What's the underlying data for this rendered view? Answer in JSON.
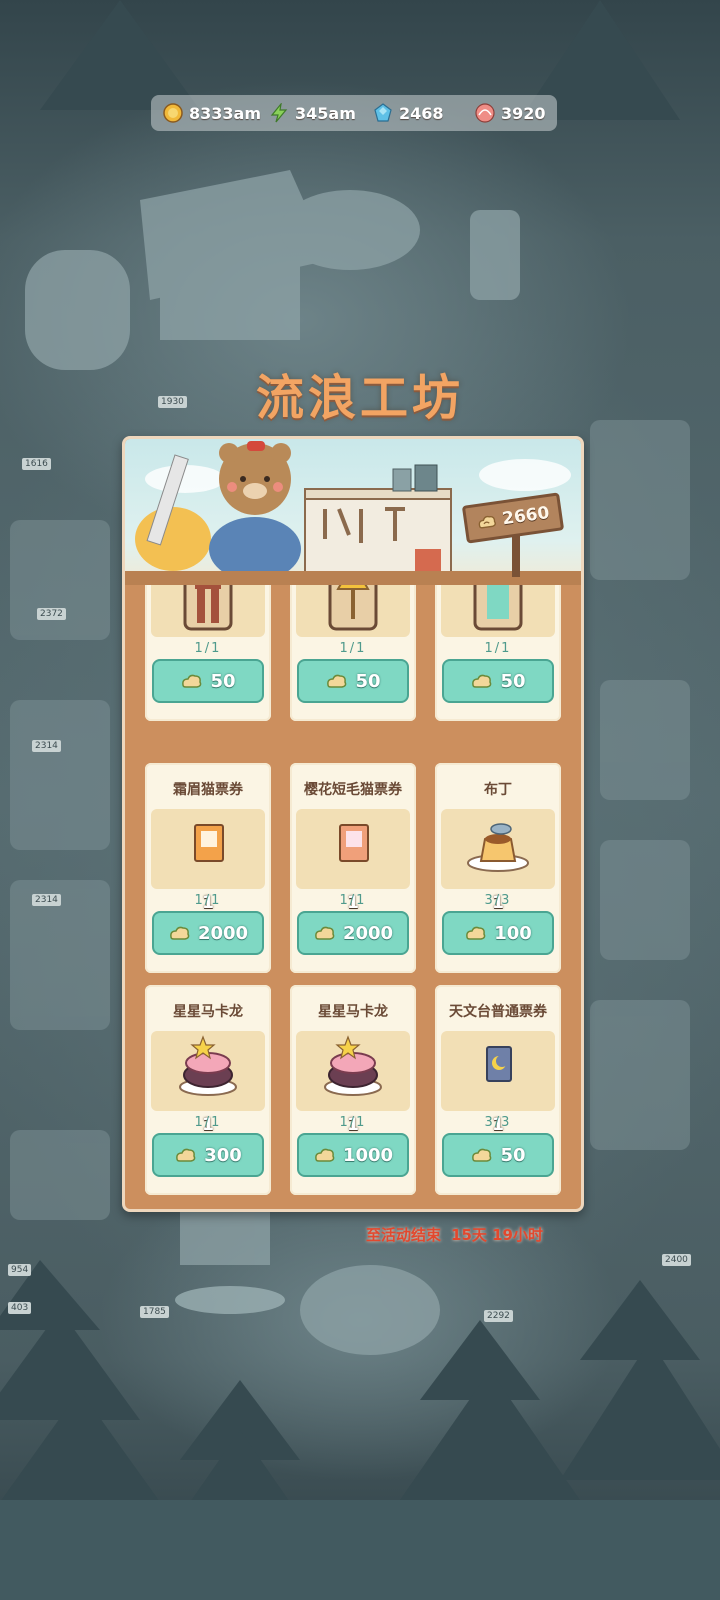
{
  "resources": [
    {
      "name": "coin",
      "icon": "gold-coin-icon",
      "value": "8333am"
    },
    {
      "name": "energy",
      "icon": "lightning-icon",
      "value": "345am"
    },
    {
      "name": "gem",
      "icon": "blue-gem-icon",
      "value": "2468"
    },
    {
      "name": "shell",
      "icon": "pink-shell-icon",
      "value": "3920"
    }
  ],
  "shop": {
    "title": "流浪工坊",
    "currency_balance": "2660",
    "currency_icon": "cloud-token-icon",
    "items": [
      {
        "name": "",
        "icon": "leather-strap-icon",
        "quantity": "",
        "stock": "1/1",
        "price": "50"
      },
      {
        "name": "",
        "icon": "golden-fan-icon",
        "quantity": "",
        "stock": "1/1",
        "price": "50"
      },
      {
        "name": "",
        "icon": "golden-roof-lantern-icon",
        "quantity": "",
        "stock": "1/1",
        "price": "50"
      },
      {
        "name": "霜眉猫票券",
        "icon": "cat-ticket-icon",
        "quantity": "1",
        "stock": "1/1",
        "price": "2000"
      },
      {
        "name": "樱花短毛猫票券",
        "icon": "sakura-cat-ticket-icon",
        "quantity": "1",
        "stock": "1/1",
        "price": "2000"
      },
      {
        "name": "布丁",
        "icon": "pudding-icon",
        "quantity": "1",
        "stock": "3/3",
        "price": "100"
      },
      {
        "name": "星星马卡龙",
        "icon": "star-macaron-icon",
        "quantity": "1",
        "stock": "1/1",
        "price": "300"
      },
      {
        "name": "星星马卡龙",
        "icon": "star-macaron-icon",
        "quantity": "1",
        "stock": "1/1",
        "price": "1000"
      },
      {
        "name": "天文台普通票券",
        "icon": "observatory-ticket-icon",
        "quantity": "1",
        "stock": "3/3",
        "price": "50"
      }
    ]
  },
  "timer": {
    "label": "至活动结束",
    "remaining": "15天 19小时"
  },
  "colors": {
    "accent": "#f2a463",
    "button": "#7fd8c3",
    "stock_text": "#4f9a8c",
    "timer_text": "#e2482e",
    "panel": "#cc8f5e"
  }
}
